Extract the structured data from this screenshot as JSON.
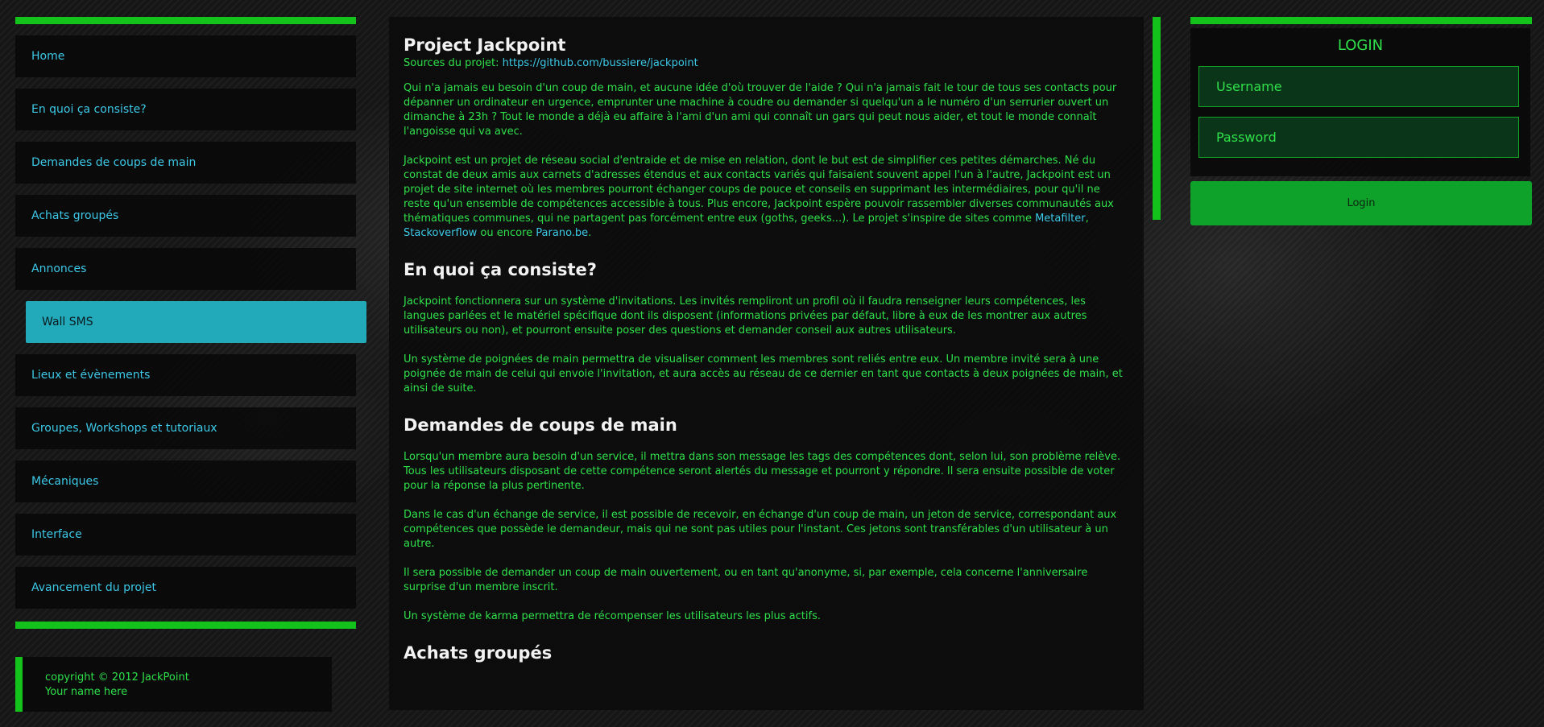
{
  "sidebar": {
    "items": [
      {
        "label": "Home"
      },
      {
        "label": "En quoi ça consiste?"
      },
      {
        "label": "Demandes de coups de main"
      },
      {
        "label": "Achats groupés"
      },
      {
        "label": "Annonces"
      },
      {
        "label": "Wall SMS",
        "active": true
      },
      {
        "label": "Lieux et évènements"
      },
      {
        "label": "Groupes, Workshops et tutoriaux"
      },
      {
        "label": "Mécaniques"
      },
      {
        "label": "Interface"
      },
      {
        "label": "Avancement du projet"
      }
    ]
  },
  "footer": {
    "copyright": "copyright © 2012 JackPoint",
    "name": "Your name here"
  },
  "main": {
    "title": "Project Jackpoint",
    "sources_label": "Sources du projet: ",
    "sources_link": "https://github.com/bussiere/jackpoint",
    "intro_p1": "Qui n'a jamais eu besoin d'un coup de main, et aucune idée d'où trouver de l'aide ? Qui n'a jamais fait le tour de tous ses contacts pour dépanner un ordinateur en urgence, emprunter une machine à coudre ou demander si quelqu'un a le numéro d'un serrurier ouvert un dimanche à 23h ? Tout le monde a déjà eu affaire à l'ami d'un ami qui connaît un gars qui peut nous aider, et tout le monde connaît l'angoisse qui va avec.",
    "intro_p2": "Jackpoint est un projet de réseau social d'entraide et de mise en relation, dont le but est de simplifier ces petites démarches. Né du constat de deux amis aux carnets d'adresses étendus et aux contacts variés qui faisaient souvent appel l'un à l'autre, Jackpoint est un projet de site internet où les membres pourront échanger coups de pouce et conseils en supprimant les intermédiaires, pour qu'il ne reste qu'un ensemble de compétences accessible à tous. Plus encore, Jackpoint espère pouvoir rassembler diverses communautés aux thématiques communes, qui ne partagent pas forcément entre eux (goths, geeks...). Le projet s'inspire de sites comme ",
    "intro_links": [
      "Metafilter",
      "Stackoverflow",
      "Parano.be"
    ],
    "intro_sep1": ", ",
    "intro_sep2": " ou encore ",
    "intro_end": ".",
    "sections": [
      {
        "heading": "En quoi ça consiste?",
        "paragraphs": [
          "Jackpoint fonctionnera sur un système d'invitations. Les invités rempliront un profil où il faudra renseigner leurs compétences, les langues parlées et le matériel spécifique dont ils disposent (informations privées par défaut, libre à eux de les montrer aux autres utilisateurs ou non), et pourront ensuite poser des questions et demander conseil aux autres utilisateurs.",
          "Un système de poignées de main permettra de visualiser comment les membres sont reliés entre eux. Un membre invité sera à une poignée de main de celui qui envoie l'invitation, et aura accès au réseau de ce dernier en tant que contacts à deux poignées de main, et ainsi de suite."
        ]
      },
      {
        "heading": "Demandes de coups de main",
        "paragraphs": [
          "Lorsqu'un membre aura besoin d'un service, il mettra dans son message les tags des compétences dont, selon lui, son problème relève. Tous les utilisateurs disposant de cette compétence seront alertés du message et pourront y répondre. Il sera ensuite possible de voter pour la réponse la plus pertinente.",
          "Dans le cas d'un échange de service, il est possible de recevoir, en échange d'un coup de main, un jeton de service, correspondant aux compétences que possède le demandeur, mais qui ne sont pas utiles pour l'instant. Ces jetons sont transférables d'un utilisateur à un autre.",
          "Il sera possible de demander un coup de main ouvertement, ou en tant qu'anonyme, si, par exemple, cela concerne l'anniversaire surprise d'un membre inscrit.",
          "Un système de karma permettra de récompenser les utilisateurs les plus actifs."
        ]
      },
      {
        "heading": "Achats groupés",
        "paragraphs": []
      }
    ]
  },
  "login": {
    "title": "LOGIN",
    "username_placeholder": "Username",
    "password_placeholder": "Password",
    "button_label": "Login"
  },
  "colors": {
    "accent_green": "#13c21a",
    "text_green": "#2fe04a",
    "link_cyan": "#3cc8e6",
    "active_item": "#22a9ba"
  }
}
